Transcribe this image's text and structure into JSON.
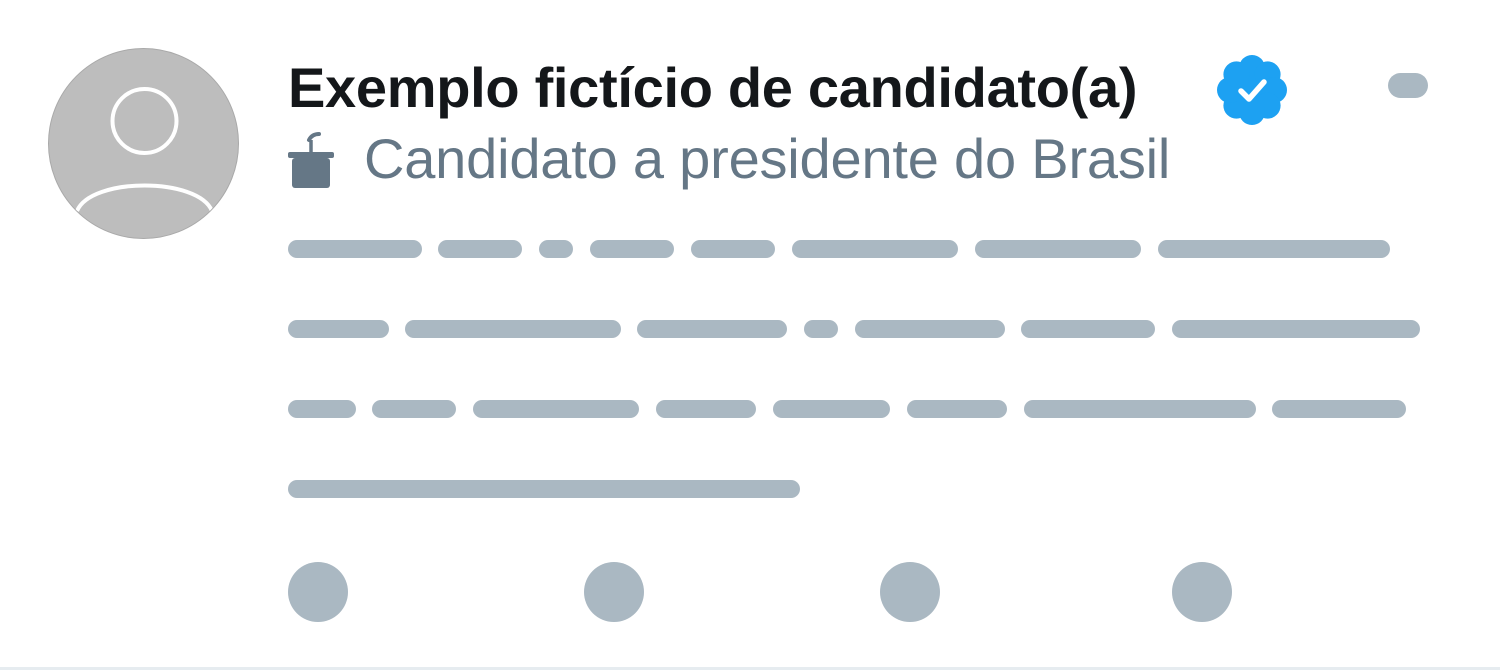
{
  "tweet": {
    "author": {
      "display_name": "Exemplo fictício de candidato(a)",
      "verified": true,
      "avatar_icon": "default-profile-avatar-icon"
    },
    "label": {
      "icon": "ballot-box-icon",
      "text": "Candidato a presidente do Brasil"
    },
    "more_menu_icon": "more-options-icon",
    "body_placeholder_lines": 4,
    "actions": [
      "reply-icon",
      "retweet-icon",
      "like-icon",
      "share-icon"
    ]
  },
  "colors": {
    "name_text": "#14171a",
    "secondary_text": "#657786",
    "placeholder": "#aab8c2",
    "verified_blue": "#1da1f2",
    "avatar_bg": "#bdbdbd",
    "label_icon": "#657786",
    "divider": "#e6ecf0"
  }
}
